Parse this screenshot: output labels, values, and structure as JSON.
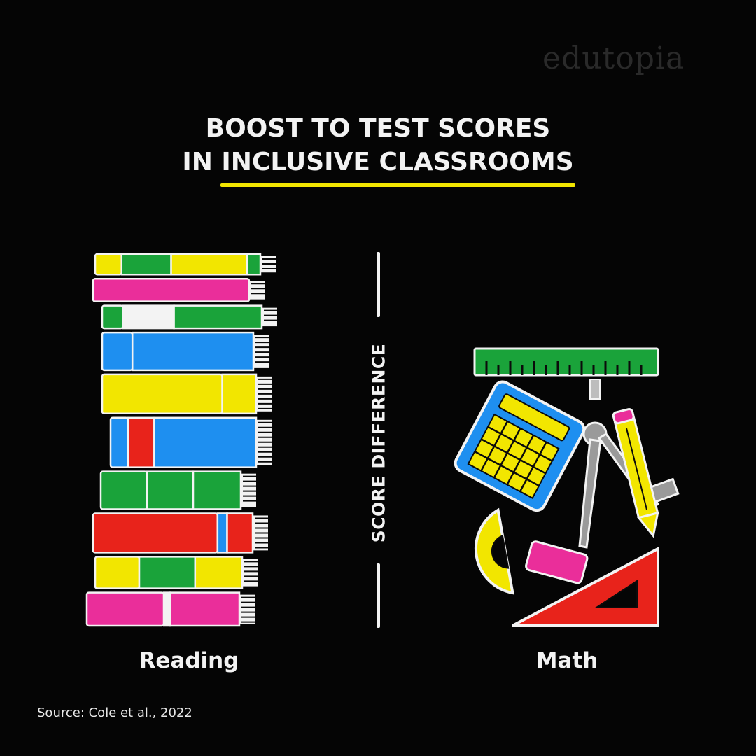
{
  "brand": "edutopia",
  "chart_data": {
    "type": "bar",
    "title": "BOOST TO TEST SCORES IN INCLUSIVE CLASSROOMS",
    "title_lines": [
      "BOOST TO TEST SCORES",
      "IN INCLUSIVE CLASSROOMS"
    ],
    "ylabel": "SCORE DIFFERENCE",
    "categories": [
      "Reading",
      "Math"
    ],
    "values": [
      1.0,
      0.8
    ],
    "value_note": "relative heights of the book stack vs. the math-tools pile",
    "colors": {
      "accent": "#f2e600",
      "yellow": "#f2e600",
      "green": "#1aa33a",
      "pink": "#ea2e9a",
      "blue": "#1e8ff0",
      "red": "#e8231b",
      "white": "#f3f3f3",
      "background": "#050505"
    },
    "source": "Source: Cole et al., 2022"
  }
}
